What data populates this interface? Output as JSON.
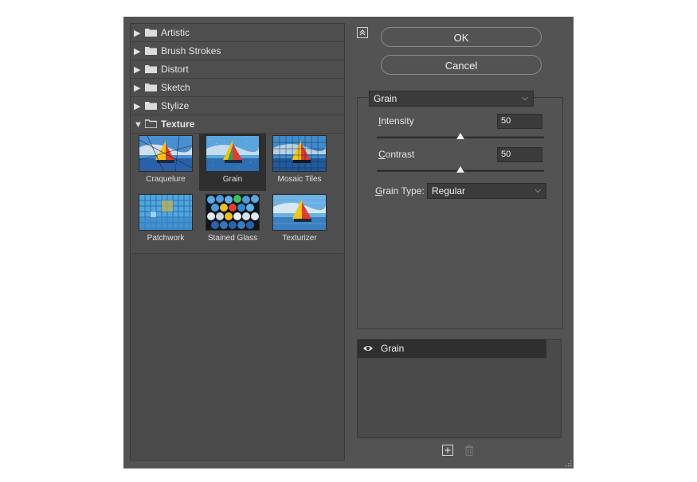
{
  "categories": [
    {
      "label": "Artistic",
      "open": false
    },
    {
      "label": "Brush Strokes",
      "open": false
    },
    {
      "label": "Distort",
      "open": false
    },
    {
      "label": "Sketch",
      "open": false
    },
    {
      "label": "Stylize",
      "open": false
    },
    {
      "label": "Texture",
      "open": true
    }
  ],
  "thumbnails": [
    {
      "caption": "Craquelure"
    },
    {
      "caption": "Grain",
      "selected": true
    },
    {
      "caption": "Mosaic Tiles"
    },
    {
      "caption": "Patchwork"
    },
    {
      "caption": "Stained Glass"
    },
    {
      "caption": "Texturizer"
    }
  ],
  "buttons": {
    "ok": "OK",
    "cancel": "Cancel"
  },
  "filter_select": {
    "value": "Grain"
  },
  "settings": {
    "intensity": {
      "label_first": "I",
      "label_rest": "ntensity",
      "value": "50",
      "min": 0,
      "max": 100
    },
    "contrast": {
      "label_first": "C",
      "label_rest": "ontrast",
      "value": "50",
      "min": 0,
      "max": 100
    },
    "grain_type": {
      "label_first": "G",
      "label_rest": "rain Type:",
      "value": "Regular"
    }
  },
  "layers": [
    {
      "name": "Grain",
      "visible": true
    }
  ],
  "icons": {
    "arrow_closed": "triangle-right-icon",
    "arrow_open": "triangle-down-icon",
    "folder": "folder-icon",
    "collapse": "collapse-up-icon",
    "eye": "eye-icon",
    "new_layer": "new-effect-layer-icon",
    "delete": "trash-icon"
  },
  "colors": {
    "dialog_bg": "#535353",
    "selection": "#2f2f2f"
  }
}
